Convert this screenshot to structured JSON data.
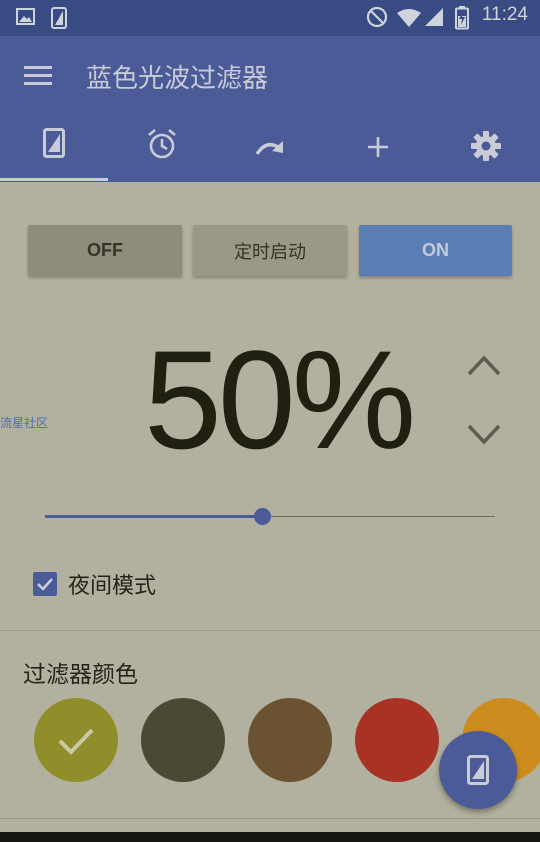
{
  "status_bar": {
    "time": "11:24",
    "icons": [
      "image-icon",
      "screen-icon",
      "do-not-disturb-icon",
      "wifi-icon",
      "signal-icon",
      "battery-charging-icon"
    ]
  },
  "app_bar": {
    "title": "蓝色光波过滤器",
    "tabs": [
      {
        "name": "tab-filter",
        "icon": "screen-icon",
        "selected": true
      },
      {
        "name": "tab-alarm",
        "icon": "alarm-icon",
        "selected": false
      },
      {
        "name": "tab-redo",
        "icon": "redo-icon",
        "selected": false
      },
      {
        "name": "tab-add",
        "icon": "plus-icon",
        "selected": false
      },
      {
        "name": "tab-settings",
        "icon": "gear-icon",
        "selected": false
      }
    ]
  },
  "controls": {
    "off_label": "OFF",
    "timer_label": "定时启动",
    "on_label": "ON"
  },
  "intensity": {
    "display": "50%",
    "value": 50
  },
  "watermark": "流星社区",
  "night_mode": {
    "label": "夜间模式",
    "checked": true
  },
  "filter_colors": {
    "title": "过滤器颜色",
    "swatches": [
      {
        "color": "#8f8e2a",
        "selected": true
      },
      {
        "color": "#4a4934",
        "selected": false
      },
      {
        "color": "#6b5233",
        "selected": false
      },
      {
        "color": "#a83325",
        "selected": false
      },
      {
        "color": "#cd8d1e",
        "selected": false
      }
    ]
  },
  "colors": {
    "primary": "#4a5b98",
    "accent_on": "#5a7db3",
    "overlay_bg": "#b2b09e"
  }
}
